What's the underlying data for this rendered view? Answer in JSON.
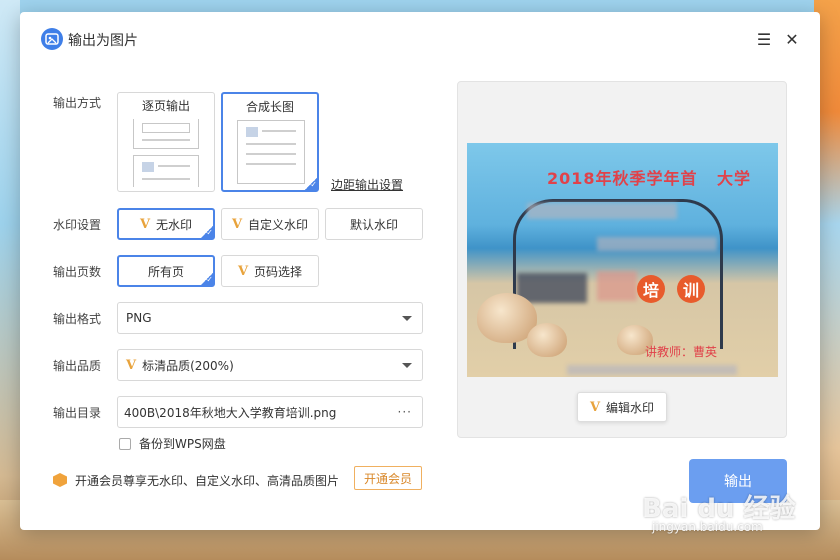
{
  "dialog": {
    "title": "输出为图片"
  },
  "labels": {
    "output_mode": "输出方式",
    "watermark": "水印设置",
    "pages": "输出页数",
    "format": "输出格式",
    "quality": "输出品质",
    "directory": "输出目录"
  },
  "output_mode": {
    "options": [
      "逐页输出",
      "合成长图"
    ],
    "selected": "合成长图",
    "margin_link": "边距输出设置"
  },
  "watermark": {
    "options": [
      "无水印",
      "自定义水印",
      "默认水印"
    ],
    "selected": "无水印"
  },
  "pages": {
    "options": [
      "所有页",
      "页码选择"
    ],
    "selected": "所有页"
  },
  "format": {
    "value": "PNG"
  },
  "quality": {
    "value": "标清品质(200%)"
  },
  "directory": {
    "value": "400B\\2018年秋地大入学教育培训.png",
    "more": "···"
  },
  "backup": {
    "label": "备份到WPS网盘",
    "checked": false
  },
  "vip": {
    "text": "开通会员尊享无水印、自定义水印、高清品质图片",
    "button": "开通会员"
  },
  "preview": {
    "title": "2018年秋季学年首",
    "title_tail": "大学",
    "chars": [
      "培",
      "训"
    ],
    "teacher": "讲教师：曹英",
    "edit_watermark": "编辑水印"
  },
  "actions": {
    "export": "输出"
  },
  "overlay": {
    "watermark_main": "Bai du 经验",
    "watermark_sub": "jingyan.baidu.com"
  },
  "colors": {
    "accent": "#4b84e8",
    "vip_orange": "#f0a33c",
    "export_btn": "#6b9ef0"
  }
}
